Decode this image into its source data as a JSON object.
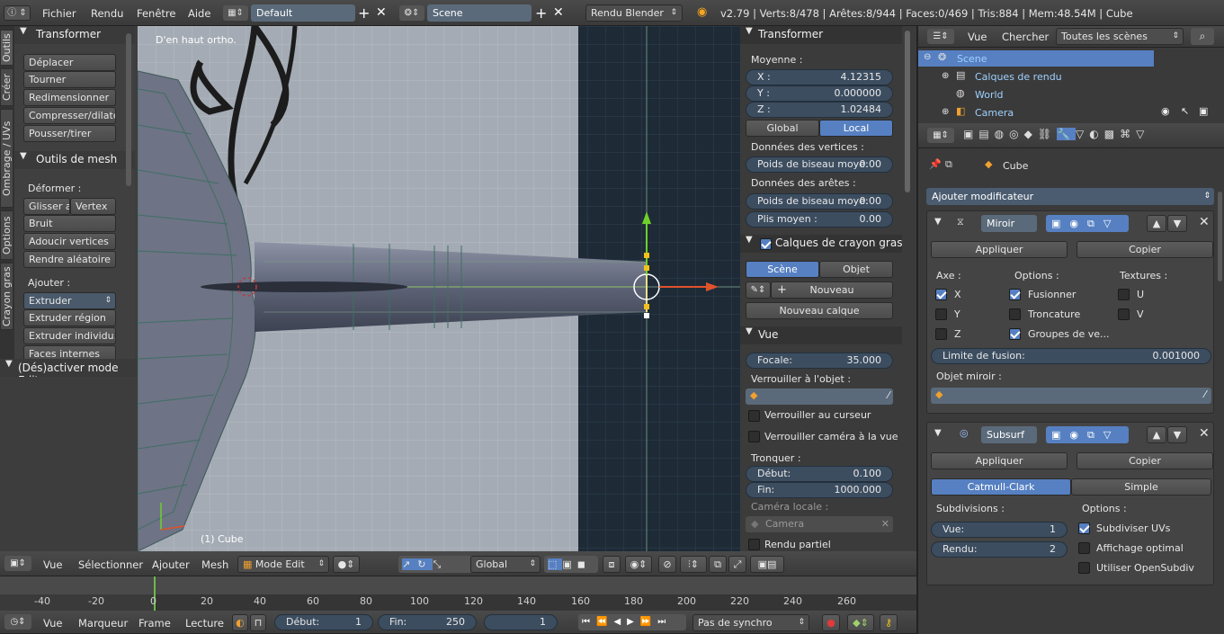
{
  "top_header": {
    "menus": [
      "Fichier",
      "Rendu",
      "Fenêtre",
      "Aide"
    ],
    "layout": "Default",
    "scene": "Scene",
    "engine": "Rendu Blender",
    "stats": "v2.79 | Verts:8/478 | Arêtes:8/944 | Faces:0/469 | Tris:884 | Mem:48.54M | Cube"
  },
  "tool_tabs": [
    "Outils",
    "Créer",
    "Ombrage / UVs",
    "Options",
    "Crayon gras"
  ],
  "tool_shelf": {
    "transform_title": "Transformer",
    "transform_buttons": [
      "Déplacer",
      "Tourner",
      "Redimensionner",
      "Compresser/dilater",
      "Pousser/tirer"
    ],
    "mesh_title": "Outils de mesh",
    "deform_label": "Déformer :",
    "slide": "Glisser a",
    "vertex": "Vertex",
    "noise": "Bruit",
    "smooth": "Adoucir vertices",
    "randomize": "Rendre aléatoire",
    "add_label": "Ajouter :",
    "extrude": "Extruder",
    "extrude_region": "Extruder région",
    "extrude_individual": "Extruder individu...",
    "inset": "Faces internes",
    "toggle_edit": "(Dés)activer mode Edit"
  },
  "viewport": {
    "view_name": "D'en haut ortho.",
    "object_info": "(1) Cube"
  },
  "properties_n": {
    "transform_title": "Transformer",
    "median": "Moyenne :",
    "x_label": "X :",
    "x": "4.12315",
    "y_label": "Y :",
    "y": "0.000000",
    "z_label": "Z :",
    "z": "1.02484",
    "global": "Global",
    "local": "Local",
    "vert_data": "Données des vertices :",
    "bevel_weight_label": "Poids de biseau moye:",
    "bevel_weight": "0.00",
    "edge_data": "Données des arêtes :",
    "edge_bevel_label": "Poids de biseau moye:",
    "edge_bevel": "0.00",
    "crease_label": "Plis moyen :",
    "crease": "0.00",
    "gp_title": "Calques de crayon gras",
    "gp_scene": "Scène",
    "gp_object": "Objet",
    "gp_new": "Nouveau",
    "gp_new_layer": "Nouveau calque",
    "view_title": "Vue",
    "focal_label": "Focale:",
    "focal": "35.000",
    "lock_object": "Verrouiller à l'objet :",
    "lock_cursor": "Verrouiller au curseur",
    "lock_camera": "Verrouiller caméra à la vue",
    "clip": "Tronquer :",
    "clip_start_label": "Début:",
    "clip_start": "0.100",
    "clip_end_label": "Fin:",
    "clip_end": "1000.000",
    "local_camera": "Caméra locale :",
    "camera": "Camera",
    "render_border": "Rendu partiel"
  },
  "outliner": {
    "view": "Vue",
    "search": "Chercher",
    "filter": "Toutes les scènes",
    "items": [
      "Scene",
      "Calques de rendu",
      "World",
      "Camera"
    ]
  },
  "properties": {
    "object_name": "Cube",
    "add_modifier": "Ajouter modificateur",
    "mirror": {
      "name": "Miroir",
      "apply": "Appliquer",
      "copy": "Copier",
      "axis": "Axe :",
      "options": "Options :",
      "textures": "Textures :",
      "x": "X",
      "y": "Y",
      "z": "Z",
      "merge": "Fusionner",
      "clipping": "Troncature",
      "vertex_groups": "Groupes de ve...",
      "u": "U",
      "v": "V",
      "merge_limit_label": "Limite de fusion:",
      "merge_limit": "0.001000",
      "mirror_object": "Objet miroir :"
    },
    "subsurf": {
      "name": "Subsurf",
      "apply": "Appliquer",
      "copy": "Copier",
      "catmull": "Catmull-Clark",
      "simple": "Simple",
      "subdivisions": "Subdivisions :",
      "options": "Options :",
      "view_label": "Vue:",
      "view": "1",
      "render_label": "Rendu:",
      "render": "2",
      "subdivide_uvs": "Subdiviser UVs",
      "optimal_display": "Affichage optimal",
      "opensubdiv": "Utiliser OpenSubdiv"
    }
  },
  "view3d_header": {
    "view": "Vue",
    "select": "Sélectionner",
    "add": "Ajouter",
    "mesh": "Mesh",
    "mode": "Mode Edit",
    "orientation": "Global"
  },
  "timeline": {
    "ticks": [
      "-40",
      "-20",
      "0",
      "20",
      "40",
      "60",
      "80",
      "100",
      "120",
      "140",
      "160",
      "180",
      "200",
      "220",
      "240",
      "260"
    ],
    "view": "Vue",
    "marker": "Marqueur",
    "frame": "Frame",
    "playback": "Lecture",
    "start_label": "Début:",
    "start": "1",
    "end_label": "Fin:",
    "end": "250",
    "current": "1",
    "sync": "Pas de synchro"
  },
  "colors": {
    "accent": "#5680c2",
    "field": "#3c4d60",
    "panel": "#3b3b3b"
  }
}
